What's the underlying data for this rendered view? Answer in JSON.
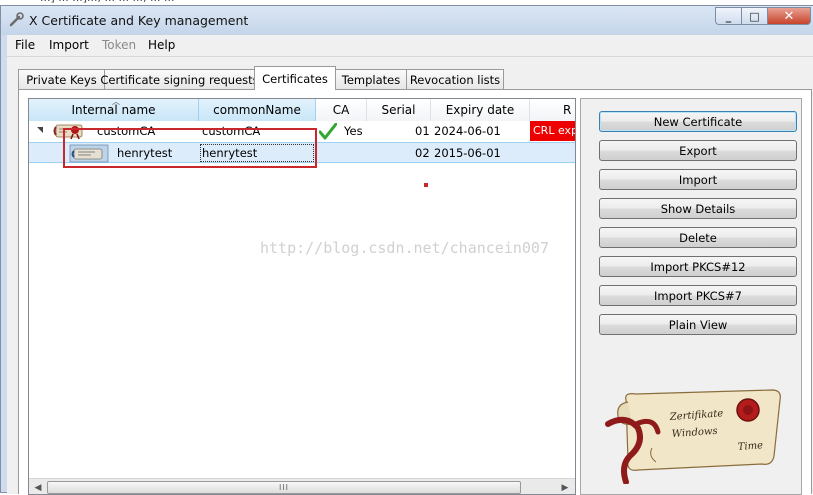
{
  "window": {
    "title": "X Certificate and Key management",
    "top_strip_text": "...] ... ...]..., ... ... ..., ... ..."
  },
  "menu": [
    "File",
    "Import",
    "Token",
    "Help"
  ],
  "tabs": [
    "Private Keys",
    "Certificate signing requests",
    "Certificates",
    "Templates",
    "Revocation lists"
  ],
  "active_tab": "Certificates",
  "columns": [
    "Internal name",
    "commonName",
    "CA",
    "Serial",
    "Expiry date",
    "R"
  ],
  "rows": [
    {
      "internal_name": "customCA",
      "common_name": "customCA",
      "ca": "Yes",
      "serial": "01",
      "expiry": "2024-06-01",
      "crl": "CRL exp"
    },
    {
      "internal_name": "henrytest",
      "common_name": "henrytest",
      "ca": "",
      "serial": "02",
      "expiry": "2015-06-01",
      "crl": ""
    }
  ],
  "watermark": "http://blog.csdn.net/chancein007",
  "buttons": [
    "New Certificate",
    "Export",
    "Import",
    "Show Details",
    "Delete",
    "Import PKCS#12",
    "Import PKCS#7",
    "Plain View"
  ],
  "logo_text": {
    "line1": "Zertifikate",
    "line2": "Windows",
    "line3": "Time"
  },
  "scrollbar_grip": "III",
  "colors": {
    "crl_expired": "#ee0000",
    "selection": "#ddecfb",
    "annotation": "#c8282d"
  }
}
